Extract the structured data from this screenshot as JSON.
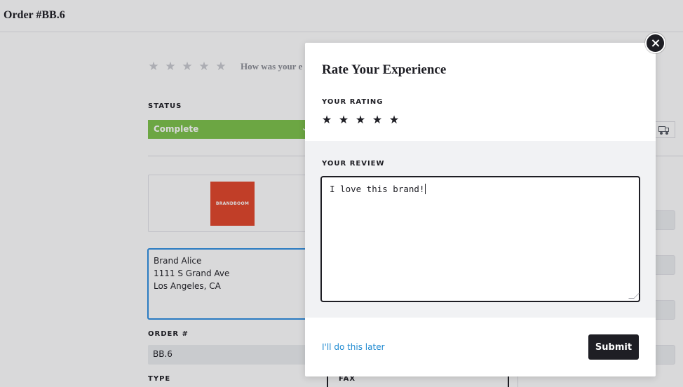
{
  "page": {
    "title": "Order #BB.6",
    "rating_prompt": "How was your e",
    "background_rating_stars": 5
  },
  "status": {
    "label": "STATUS",
    "value": "Complete",
    "color": "#7cc24a"
  },
  "brand": {
    "logo_text": "BRANDBOOM",
    "logo_color": "#e2452a"
  },
  "address": {
    "lines": [
      "Brand Alice",
      "1111 S Grand Ave",
      "Los Angeles, CA"
    ]
  },
  "order": {
    "label": "ORDER #",
    "value": "BB.6"
  },
  "type": {
    "label": "TYPE"
  },
  "fax": {
    "label": "FAX"
  },
  "icons": {
    "truck": "truck-icon",
    "close": "close-icon",
    "star": "star-icon"
  },
  "modal": {
    "title": "Rate Your Experience",
    "rating_label": "YOUR RATING",
    "rating_value": 5,
    "rating_max": 5,
    "review_label": "YOUR REVIEW",
    "review_text": "I love this brand!",
    "later_link": "I'll do this later",
    "submit_label": "Submit",
    "accent_color": "#1f8ad1"
  }
}
